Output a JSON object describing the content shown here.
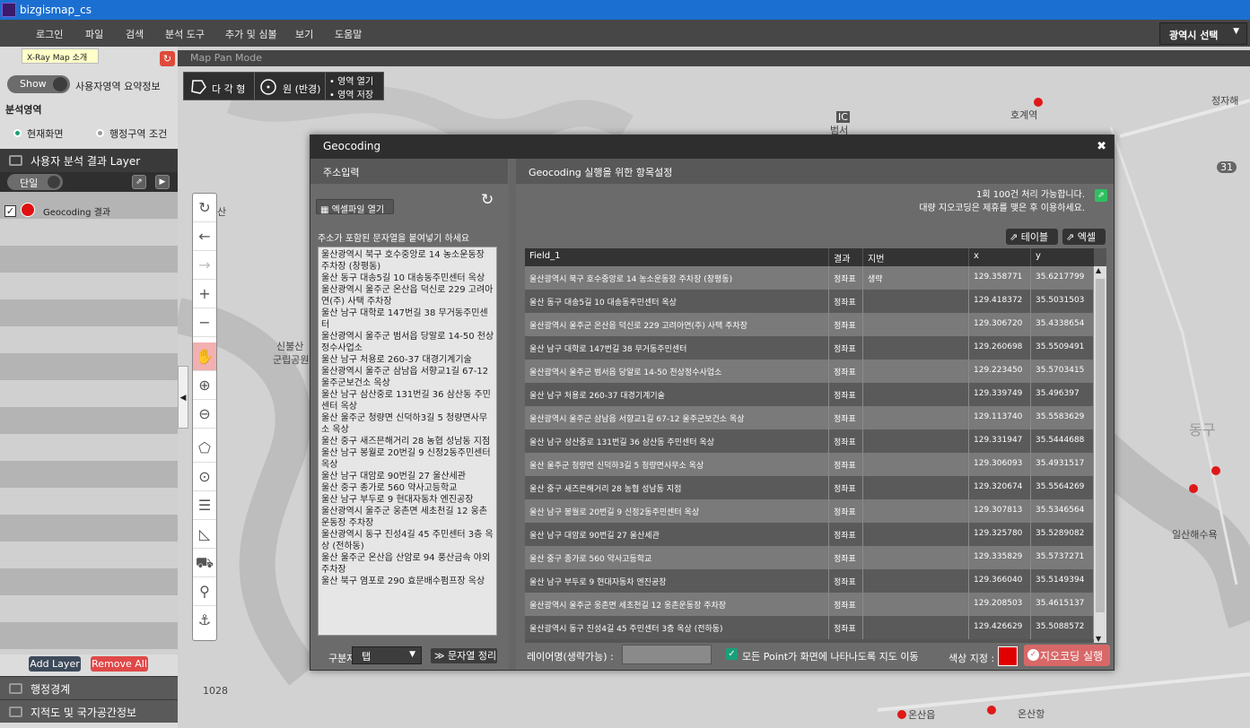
{
  "app": {
    "title": "bizgismap_cs"
  },
  "menu": [
    "로그인",
    "파일",
    "검색",
    "분석 도구",
    "추가 및 심볼",
    "보기",
    "도움말"
  ],
  "region_select": "광역시 선택",
  "left_panel": {
    "tooltip": "X-Ray Map 소개",
    "show_label": "Show",
    "summary_label": "사용자영역 요약정보",
    "analysis_area": "분석영역",
    "radio_screen": "현재화면",
    "radio_admin": "행정구역 조건",
    "layer_header": "사용자 분석 결과 Layer",
    "single_label": "단일",
    "layer_name": "Geocoding 결과",
    "add_layer": "Add Layer",
    "remove_all": "Remove All",
    "bottom_items": [
      "행정경계",
      "지적도 및 국가공간정보"
    ]
  },
  "map": {
    "mode": "Map Pan Mode",
    "shape_polygon": "다 각 형",
    "shape_circle": "원 (반경)",
    "area_open": "• 영역 열기",
    "area_save": "• 영역 저장",
    "labels": [
      "호계역",
      "IC",
      "범서",
      "정자해",
      "31",
      "신불산",
      "군립공원",
      "동구",
      "일산해수욕",
      "1028",
      "온산읍",
      "온산항",
      "산"
    ]
  },
  "dialog": {
    "title": "Geocoding",
    "left_header": "주소입력",
    "excel_open": "엑셀파일 열기",
    "paste_label": "주소가 포함된 문자열을 붙여넣기 하세요",
    "addresses": [
      "울산광역시 북구 호수중앙로 14 농소운동장 주차장 (창평동)",
      "울산 동구 대송5길 10 대송동주민센터 옥상",
      "울산광역시 울주군 온산읍 덕신로 229 고려아연(주) 사택 주차장",
      "울산 남구 대학로 147번길 38 무거동주민센터",
      "울산광역시 울주군 범서읍 당알로 14-50 천상정수사업소",
      "울산 남구 처용로 260-37 대경기계기술",
      "울산광역시 울주군 삼남읍 서향교1길 67-12 울주군보건소 옥상",
      "울산 남구 삼산중로 131번길 36 삼산동 주민센터 옥상",
      "울산 울주군 청량면 신덕하3길 5 청량면사무소 옥상",
      "울산 중구 새즈믄해거리 28 농협 성남동 지점",
      "울산 남구 봉월로 20번길 9 신정2동주민센터 옥상",
      "울산 남구 대암로 90번길 27 울산세관",
      "울산 중구 종가로 560 약사고등학교",
      "울산 남구 부두로 9 현대자동차 엔진공장",
      "울산광역시 울주군 웅촌면 세초천길 12 웅촌운동장 주차장",
      "울산광역시 동구 진성4길 45 주민센터 3층 옥상 (전하동)",
      "울산 울주군 온산읍 산암로 94 풍산금속 야외 주차장",
      "울산 북구 염포로 290 효문배수펌프장 옥상"
    ],
    "separator_label": "구분자",
    "separator_value": "탭",
    "clean_button": "≫ 문자열 정리",
    "right_header": "Geocoding 실행을 위한 항목설정",
    "info_line1": "1회 100건 처리 가능합니다.",
    "info_line2": "대량 지오코딩은 제휴를 맺은 후 이용하세요.",
    "table_button": "테이블",
    "excel_button": "엑셀",
    "columns": [
      "Field_1",
      "결과",
      "지번",
      "x",
      "y"
    ],
    "rows": [
      [
        "울산광역시 북구 호수중앙로 14 농소운동장 주차장 (창평동)",
        "정좌표",
        "생략",
        "129.358771",
        "35.6217799"
      ],
      [
        "울산 동구 대송5길 10 대송동주민센터 옥상",
        "정좌표",
        "",
        "129.418372",
        "35.5031503"
      ],
      [
        "울산광역시 울주군 온산읍 덕신로 229 고려아연(주) 사택 주차장",
        "정좌표",
        "",
        "129.306720",
        "35.4338654"
      ],
      [
        "울산 남구 대학로 147번길 38 무거동주민센터",
        "정좌표",
        "",
        "129.260698",
        "35.5509491"
      ],
      [
        "울산광역시 울주군 범서읍 당알로 14-50 천상정수사업소",
        "정좌표",
        "",
        "129.223450",
        "35.5703415"
      ],
      [
        "울산 남구 처용로 260-37 대경기계기술",
        "정좌표",
        "",
        "129.339749",
        "35.496397"
      ],
      [
        "울산광역시 울주군 삼남읍 서향교1길 67-12 울주군보건소 옥상",
        "정좌표",
        "",
        "129.113740",
        "35.5583629"
      ],
      [
        "울산 남구 삼산중로 131번길 36 삼산동 주민센터 옥상",
        "정좌표",
        "",
        "129.331947",
        "35.5444688"
      ],
      [
        "울산 울주군 청량면 신덕하3길 5 청량면사무소 옥상",
        "정좌표",
        "",
        "129.306093",
        "35.4931517"
      ],
      [
        "울산 중구 새즈믄해거리 28 농협 성남동 지점",
        "정좌표",
        "",
        "129.320674",
        "35.5564269"
      ],
      [
        "울산 남구 봉월로 20번길 9 신정2동주민센터 옥상",
        "정좌표",
        "",
        "129.307813",
        "35.5346564"
      ],
      [
        "울산 남구 대암로 90번길 27 울산세관",
        "정좌표",
        "",
        "129.325780",
        "35.5289082"
      ],
      [
        "울산 중구 종가로 560 약사고등학교",
        "정좌표",
        "",
        "129.335829",
        "35.5737271"
      ],
      [
        "울산 남구 부두로 9 현대자동차 엔진공장",
        "정좌표",
        "",
        "129.366040",
        "35.5149394"
      ],
      [
        "울산광역시 울주군 웅촌면 세초천길 12 웅촌운동장 주차장",
        "정좌표",
        "",
        "129.208503",
        "35.4615137"
      ],
      [
        "울산광역시 동구 진성4길 45 주민센터 3층 옥상 (전하동)",
        "정좌표",
        "",
        "129.426629",
        "35.5088572"
      ]
    ],
    "layer_name_label": "레이어명(생략가능) :",
    "show_all_label": "모든 Point가 화면에 나타나도록 지도 이동",
    "color_label": "색상 지정 :",
    "run_button": "지오코딩 실행"
  }
}
